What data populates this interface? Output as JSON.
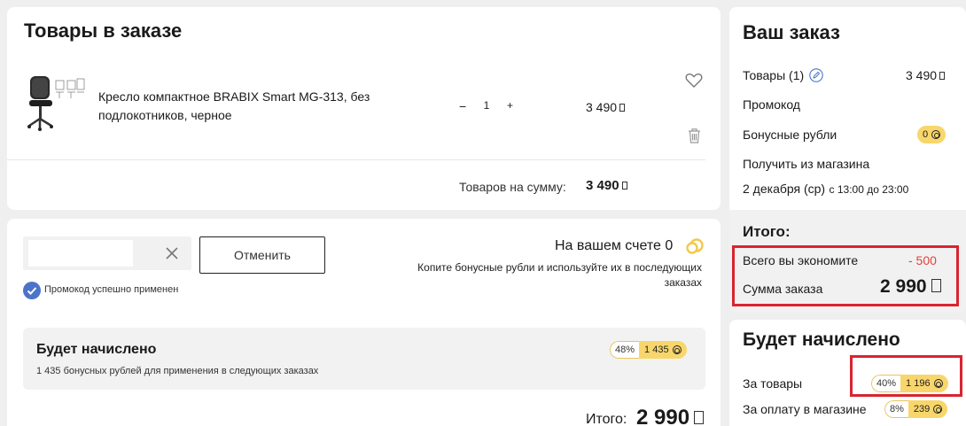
{
  "cart": {
    "title": "Товары в заказе",
    "item": {
      "name": "Кресло компактное BRABIX Smart MG-313, без подлокотников, черное",
      "minus": "−",
      "qty": "1",
      "plus": "+",
      "price": "3 490"
    },
    "subtotal_label": "Товаров на сумму:",
    "subtotal_value": "3 490"
  },
  "promo": {
    "input_value": "",
    "cancel_label": "Отменить",
    "applied_text": "Промокод успешно применен",
    "account_label": "На вашем счете 0",
    "account_hint": "Копите бонусные рубли и используйте их в последующих заказах",
    "accrual_title": "Будет начислено",
    "accrual_pct": "48%",
    "accrual_amount": "1 435",
    "accrual_desc": "1 435 бонусных рублей для применения в следующих заказах",
    "total_label": "Итого:",
    "total_value": "2 990"
  },
  "order": {
    "title": "Ваш заказ",
    "items_label": "Товары (1)",
    "items_value": "3 490",
    "promocode_label": "Промокод",
    "bonus_label": "Бонусные рубли",
    "bonus_value": "0",
    "pickup_label": "Получить из магазина",
    "pickup_date": "2 декабря (ср)",
    "pickup_time": "с 13:00 до 23:00",
    "total_title": "Итого:",
    "savings_label": "Всего вы экономите",
    "savings_value": "- 500",
    "sum_label": "Сумма заказа",
    "sum_value": "2 990"
  },
  "earn": {
    "title": "Будет начислено",
    "goods_label": "За товары",
    "goods_pct": "40%",
    "goods_amount": "1 196",
    "store_label": "За оплату в магазине",
    "store_pct": "8%",
    "store_amount": "239"
  },
  "colors": {
    "highlight_border": "#d92430",
    "bonus_pill": "#f8d66b",
    "savings_text": "#e0433a",
    "check_blue": "#4b74c9"
  }
}
